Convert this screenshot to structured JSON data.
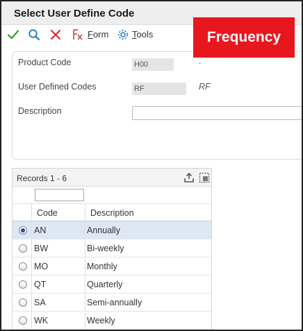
{
  "window": {
    "title": "Select User Define Code"
  },
  "toolbar": {
    "select_icon": "check-icon",
    "find_icon": "search-icon",
    "close_icon": "close-icon",
    "form_label_accel": "F",
    "form_label_rest": "orm",
    "tools_label_accel": "T",
    "tools_label_rest": "ools"
  },
  "annotation": {
    "text": "Frequency",
    "color": "#e8171d"
  },
  "form": {
    "product_code_label": "Product Code",
    "product_code_value": "H00",
    "product_code_extra": ".",
    "udc_label": "User Defined Codes",
    "udc_value": "RF",
    "udc_extra": "RF",
    "description_label": "Description",
    "description_value": ""
  },
  "grid": {
    "records_label": "Records 1 - 6",
    "qbe_value": "",
    "columns": {
      "code": "Code",
      "description": "Description"
    },
    "rows": [
      {
        "code": "AN",
        "description": "Annually",
        "selected": true
      },
      {
        "code": "BW",
        "description": "Bi-weekly",
        "selected": false
      },
      {
        "code": "MO",
        "description": "Monthly",
        "selected": false
      },
      {
        "code": "QT",
        "description": "Quarterly",
        "selected": false
      },
      {
        "code": "SA",
        "description": "Semi-annually",
        "selected": false
      },
      {
        "code": "WK",
        "description": "Weekly",
        "selected": false
      }
    ]
  },
  "colors": {
    "selected_row": "#dde8f4",
    "check": "#3a9b2b",
    "search": "#2a7fc1",
    "close": "#d9262c"
  }
}
